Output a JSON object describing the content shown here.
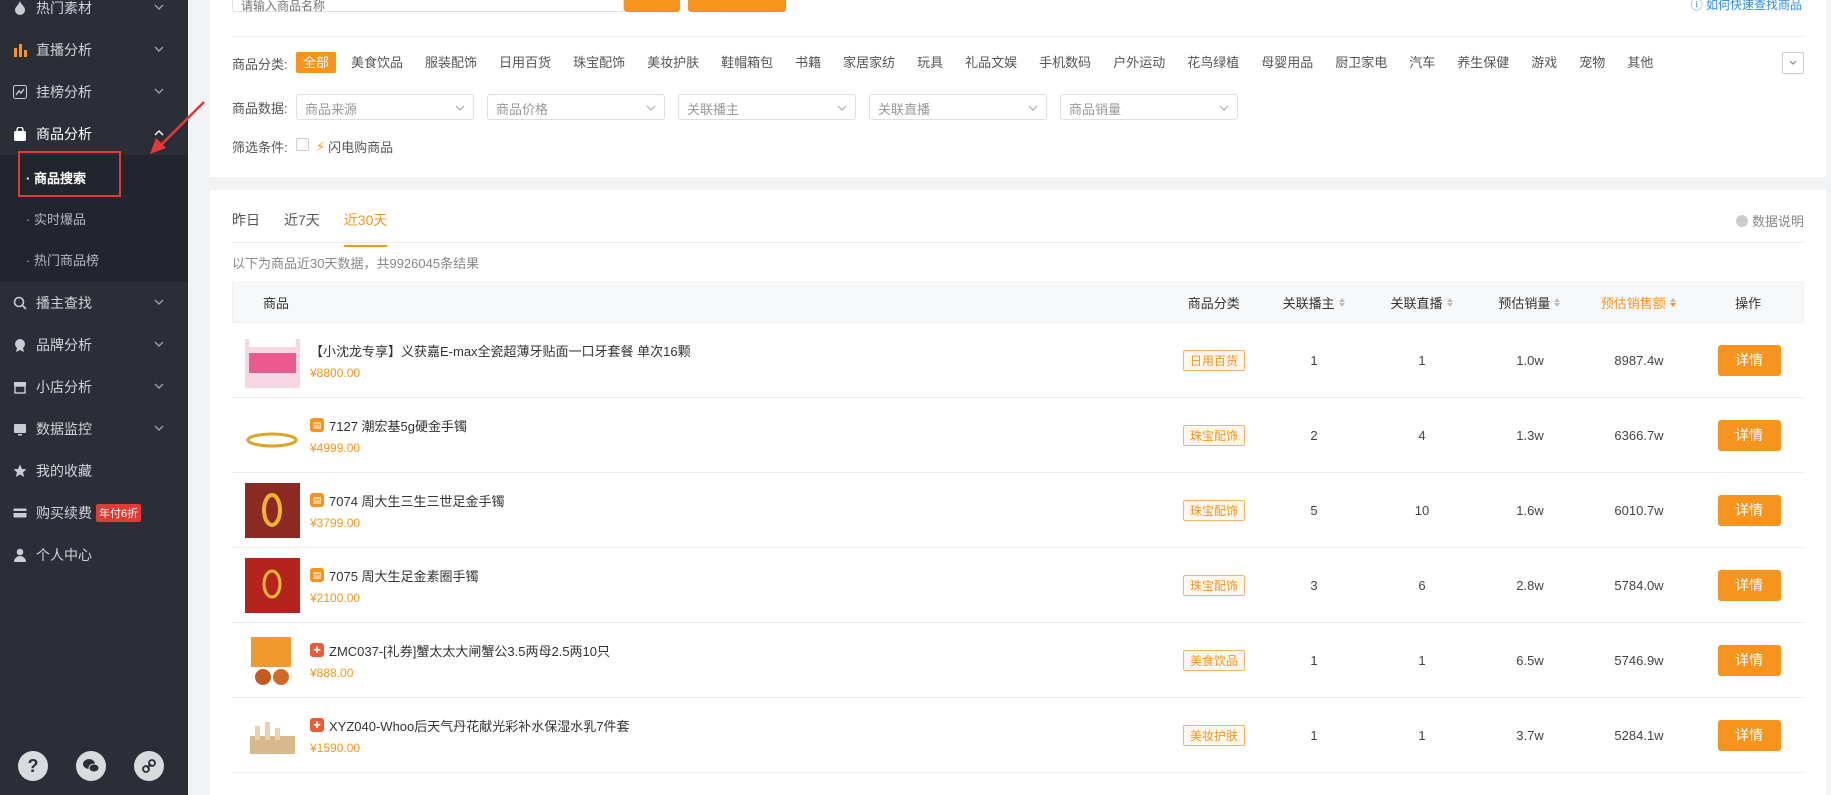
{
  "sidebar": {
    "items": [
      {
        "label": "热门素材",
        "icon": "flame-icon"
      },
      {
        "label": "直播分析",
        "icon": "bar-chart-icon"
      },
      {
        "label": "挂榜分析",
        "icon": "line-chart-icon"
      },
      {
        "label": "商品分析",
        "icon": "bag-icon"
      },
      {
        "label": "播主查找",
        "icon": "search-icon"
      },
      {
        "label": "品牌分析",
        "icon": "medal-icon"
      },
      {
        "label": "小店分析",
        "icon": "store-icon"
      },
      {
        "label": "数据监控",
        "icon": "monitor-icon"
      },
      {
        "label": "我的收藏",
        "icon": "star-icon"
      },
      {
        "label": "购买续费",
        "icon": "card-icon",
        "badge": "年付6折"
      },
      {
        "label": "个人中心",
        "icon": "user-icon"
      }
    ],
    "sub_items": [
      "· 商品搜索",
      "· 实时爆品",
      "· 热门商品榜"
    ]
  },
  "filters": {
    "search_placeholder": "请输入商品名称",
    "help_link": "ⓘ 如何快速查找商品",
    "category_label": "商品分类:",
    "categories": [
      "全部",
      "美食饮品",
      "服装配饰",
      "日用百货",
      "珠宝配饰",
      "美妆护肤",
      "鞋帽箱包",
      "书籍",
      "家居家纺",
      "玩具",
      "礼品文娱",
      "手机数码",
      "户外运动",
      "花鸟绿植",
      "母婴用品",
      "厨卫家电",
      "汽车",
      "养生保健",
      "游戏",
      "宠物",
      "其他"
    ],
    "data_label": "商品数据:",
    "selects": [
      "商品来源",
      "商品价格",
      "关联播主",
      "关联直播",
      "商品销量"
    ],
    "condition_label": "筛选条件:",
    "flash_label": "闪电购商品"
  },
  "results": {
    "tabs": [
      "昨日",
      "近7天",
      "近30天"
    ],
    "active_tab": 2,
    "data_note": "数据说明",
    "summary": "以下为商品近30天数据，共9926045条结果",
    "columns": [
      "商品",
      "商品分类",
      "关联播主",
      "关联直播",
      "预估销量",
      "预估销售额",
      "操作"
    ],
    "detail_label": "详情",
    "rows": [
      {
        "title": "【小沈龙专享】义获嘉E-max全瓷超薄牙贴面一口牙套餐 单次16颗",
        "price": "¥8800.00",
        "category": "日用百货",
        "anchors": "1",
        "lives": "1",
        "volume": "1.0w",
        "amount": "8987.4w",
        "src": ""
      },
      {
        "title": "7127 潮宏基5g硬金手镯",
        "price": "¥4999.00",
        "category": "珠宝配饰",
        "anchors": "2",
        "lives": "4",
        "volume": "1.3w",
        "amount": "6366.7w",
        "src": "o"
      },
      {
        "title": "7074 周大生三生三世足金手镯",
        "price": "¥3799.00",
        "category": "珠宝配饰",
        "anchors": "5",
        "lives": "10",
        "volume": "1.6w",
        "amount": "6010.7w",
        "src": "o"
      },
      {
        "title": "7075 周大生足金素圈手镯",
        "price": "¥2100.00",
        "category": "珠宝配饰",
        "anchors": "3",
        "lives": "6",
        "volume": "2.8w",
        "amount": "5784.0w",
        "src": "o"
      },
      {
        "title": "ZMC037-[礼券]蟹太太大闸蟹公3.5两母2.5两10只",
        "price": "¥888.00",
        "category": "美食饮品",
        "anchors": "1",
        "lives": "1",
        "volume": "6.5w",
        "amount": "5746.9w",
        "src": "r"
      },
      {
        "title": "XYZ040-Whoo后天气丹花献光彩补水保湿水乳7件套",
        "price": "¥1590.00",
        "category": "美妆护肤",
        "anchors": "1",
        "lives": "1",
        "volume": "3.7w",
        "amount": "5284.1w",
        "src": "r"
      }
    ]
  },
  "colors": {
    "accent": "#f7941d",
    "sidebar": "#2b2e37",
    "highlight": "#e53935"
  }
}
